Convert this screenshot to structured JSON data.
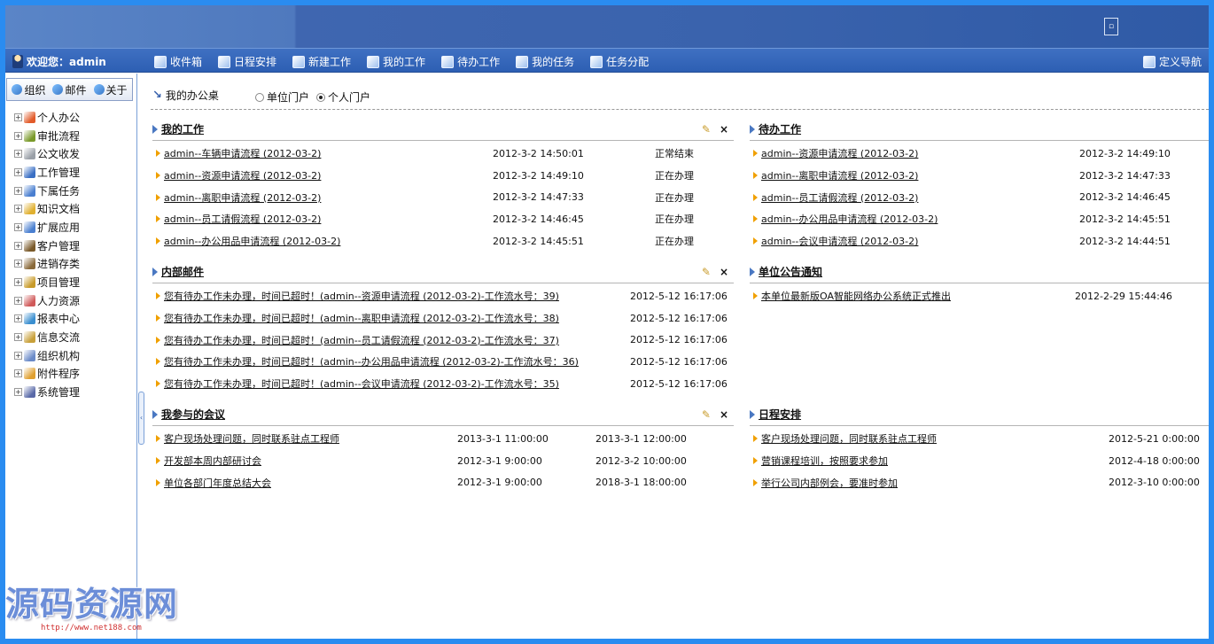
{
  "banner": {
    "button_label": "▫"
  },
  "menubar": {
    "welcome": "欢迎您：admin",
    "items": [
      {
        "label": "收件箱",
        "name": "menu-inbox"
      },
      {
        "label": "日程安排",
        "name": "menu-schedule"
      },
      {
        "label": "新建工作",
        "name": "menu-new-work"
      },
      {
        "label": "我的工作",
        "name": "menu-my-work"
      },
      {
        "label": "待办工作",
        "name": "menu-todo"
      },
      {
        "label": "我的任务",
        "name": "menu-my-tasks"
      },
      {
        "label": "任务分配",
        "name": "menu-assign"
      }
    ],
    "custom_nav": "定义导航"
  },
  "sidebar": {
    "tabs": [
      "组织",
      "邮件",
      "关于"
    ],
    "tree": [
      {
        "label": "个人办公",
        "color": "#e25b2a"
      },
      {
        "label": "审批流程",
        "color": "#7a9a2a"
      },
      {
        "label": "公文收发",
        "color": "#9aa0a8"
      },
      {
        "label": "工作管理",
        "color": "#3a6fc4"
      },
      {
        "label": "下属任务",
        "color": "#4a7fd0"
      },
      {
        "label": "知识文档",
        "color": "#e0b030"
      },
      {
        "label": "扩展应用",
        "color": "#4a7fd0"
      },
      {
        "label": "客户管理",
        "color": "#7a5a2a"
      },
      {
        "label": "进销存类",
        "color": "#8a6a3a"
      },
      {
        "label": "项目管理",
        "color": "#c89b2a"
      },
      {
        "label": "人力资源",
        "color": "#d05a5a"
      },
      {
        "label": "报表中心",
        "color": "#3a8fd0"
      },
      {
        "label": "信息交流",
        "color": "#c8a03a"
      },
      {
        "label": "组织机构",
        "color": "#6a8ac8"
      },
      {
        "label": "附件程序",
        "color": "#e0a030"
      },
      {
        "label": "系统管理",
        "color": "#5a6aa8"
      }
    ]
  },
  "main": {
    "crumb": "我的办公桌",
    "portal_options": [
      "单位门户",
      "个人门户"
    ],
    "my_work": {
      "title": "我的工作",
      "rows": [
        {
          "title": "admin--车辆申请流程 (2012-03-2)",
          "time": "2012-3-2 14:50:01",
          "status": "正常结束"
        },
        {
          "title": "admin--资源申请流程 (2012-03-2)",
          "time": "2012-3-2 14:49:10",
          "status": "正在办理"
        },
        {
          "title": "admin--离职申请流程 (2012-03-2)",
          "time": "2012-3-2 14:47:33",
          "status": "正在办理"
        },
        {
          "title": "admin--员工请假流程 (2012-03-2)",
          "time": "2012-3-2 14:46:45",
          "status": "正在办理"
        },
        {
          "title": "admin--办公用品申请流程 (2012-03-2)",
          "time": "2012-3-2 14:45:51",
          "status": "正在办理"
        }
      ]
    },
    "todo": {
      "title": "待办工作",
      "rows": [
        {
          "title": "admin--资源申请流程 (2012-03-2)",
          "time": "2012-3-2 14:49:10"
        },
        {
          "title": "admin--离职申请流程 (2012-03-2)",
          "time": "2012-3-2 14:47:33"
        },
        {
          "title": "admin--员工请假流程 (2012-03-2)",
          "time": "2012-3-2 14:46:45"
        },
        {
          "title": "admin--办公用品申请流程 (2012-03-2)",
          "time": "2012-3-2 14:45:51"
        },
        {
          "title": "admin--会议申请流程 (2012-03-2)",
          "time": "2012-3-2 14:44:51"
        }
      ]
    },
    "mail": {
      "title": "内部邮件",
      "rows": [
        {
          "title": "您有待办工作未办理，时间已超时！(admin--资源申请流程 (2012-03-2)-工作流水号：39)",
          "time": "2012-5-12 16:17:06"
        },
        {
          "title": "您有待办工作未办理，时间已超时！(admin--离职申请流程 (2012-03-2)-工作流水号：38)",
          "time": "2012-5-12 16:17:06"
        },
        {
          "title": "您有待办工作未办理，时间已超时！(admin--员工请假流程 (2012-03-2)-工作流水号：37)",
          "time": "2012-5-12 16:17:06"
        },
        {
          "title": "您有待办工作未办理，时间已超时！(admin--办公用品申请流程 (2012-03-2)-工作流水号：36)",
          "time": "2012-5-12 16:17:06"
        },
        {
          "title": "您有待办工作未办理，时间已超时！(admin--会议申请流程 (2012-03-2)-工作流水号：35)",
          "time": "2012-5-12 16:17:06"
        }
      ]
    },
    "notice": {
      "title": "单位公告通知",
      "rows": [
        {
          "title": "本单位最新版OA智能网络办公系统正式推出",
          "time": "2012-2-29 15:44:46"
        }
      ]
    },
    "meetings": {
      "title": "我参与的会议",
      "rows": [
        {
          "title": "客户现场处理问题，同时联系驻点工程师",
          "start": "2013-3-1 11:00:00",
          "end": "2013-3-1 12:00:00"
        },
        {
          "title": "开发部本周内部研讨会",
          "start": "2012-3-1 9:00:00",
          "end": "2012-3-2 10:00:00"
        },
        {
          "title": "单位各部门年度总结大会",
          "start": "2012-3-1 9:00:00",
          "end": "2018-3-1 18:00:00"
        }
      ]
    },
    "schedule": {
      "title": "日程安排",
      "rows": [
        {
          "title": "客户现场处理问题，同时联系驻点工程师",
          "time": "2012-5-21 0:00:00"
        },
        {
          "title": "营销课程培训，按照要求参加",
          "time": "2012-4-18 0:00:00"
        },
        {
          "title": "举行公司内部例会，要准时参加",
          "time": "2012-3-10 0:00:00"
        }
      ]
    }
  },
  "watermark": {
    "text": "源码资源网",
    "url": "http://www.net188.com"
  }
}
